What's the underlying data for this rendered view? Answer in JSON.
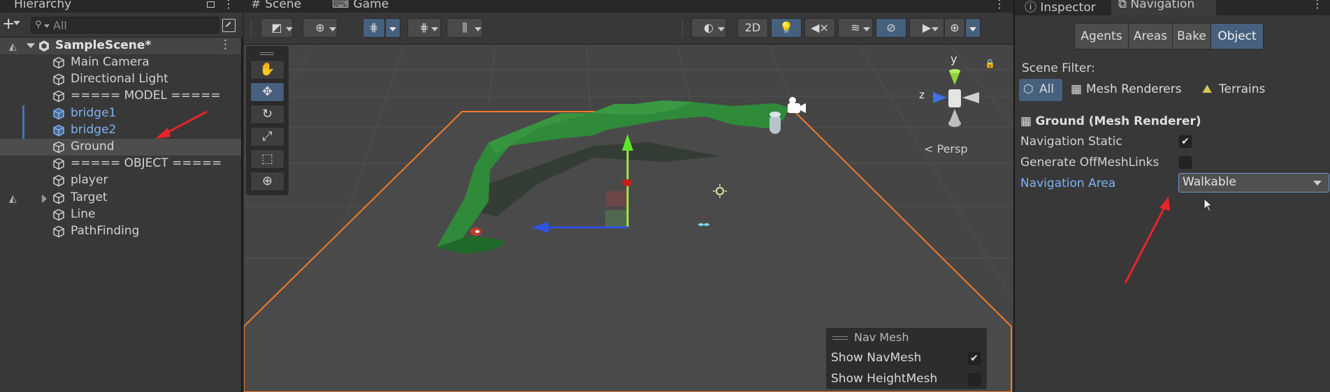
{
  "hierarchy": {
    "tab_label": "Hierarchy",
    "search_placeholder": "All",
    "add_label": "+",
    "scene": {
      "name": "SampleScene*"
    },
    "items": [
      {
        "label": "Main Camera",
        "prefab": false
      },
      {
        "label": "Directional Light",
        "prefab": false
      },
      {
        "label": "===== MODEL =====",
        "prefab": false
      },
      {
        "label": "bridge1",
        "prefab": true
      },
      {
        "label": "bridge2",
        "prefab": true
      },
      {
        "label": "Ground",
        "prefab": false,
        "selected": true
      },
      {
        "label": "===== OBJECT =====",
        "prefab": false
      },
      {
        "label": "player",
        "prefab": false
      },
      {
        "label": "Target",
        "prefab": false,
        "has_children": true
      },
      {
        "label": "Line",
        "prefab": false
      },
      {
        "label": "PathFinding",
        "prefab": false
      }
    ]
  },
  "scene_view": {
    "tabs": [
      {
        "label": "Scene",
        "icon": "grid-icon",
        "active": true
      },
      {
        "label": "Game",
        "icon": "gamepad-icon",
        "active": false
      }
    ],
    "toolbar": {
      "mode_2d_label": "2D"
    },
    "projection_label": "Persp",
    "gizmo_axes": {
      "y": "y",
      "z": "z"
    },
    "navmesh_overlay": {
      "title": "Nav Mesh",
      "options": [
        {
          "label": "Show NavMesh",
          "checked": true
        },
        {
          "label": "Show HeightMesh",
          "checked": false
        }
      ]
    },
    "colors": {
      "selection_outline": "#f07a2a",
      "navmesh_green": "#2f8a3a",
      "ground": "#454545"
    }
  },
  "right_panel": {
    "tabs": [
      {
        "label": "Inspector",
        "icon": "info-icon",
        "active": false
      },
      {
        "label": "Navigation",
        "icon": "navigation-icon",
        "active": true
      }
    ],
    "nav_tabs": [
      {
        "label": "Agents",
        "active": false
      },
      {
        "label": "Areas",
        "active": false
      },
      {
        "label": "Bake",
        "active": false
      },
      {
        "label": "Object",
        "active": true
      }
    ],
    "scene_filter_label": "Scene Filter:",
    "filters": [
      {
        "label": "All",
        "icon": "cube-icon",
        "active": true
      },
      {
        "label": "Mesh Renderers",
        "icon": "mesh-renderer-icon",
        "active": false
      },
      {
        "label": "Terrains",
        "icon": "terrain-icon",
        "active": false
      }
    ],
    "object_title": "Ground (Mesh Renderer)",
    "fields": {
      "navigation_static": {
        "label": "Navigation Static",
        "checked": true
      },
      "generate_offmesh": {
        "label": "Generate OffMeshLinks",
        "checked": false
      },
      "navigation_area": {
        "label": "Navigation Area",
        "value": "Walkable"
      }
    }
  }
}
